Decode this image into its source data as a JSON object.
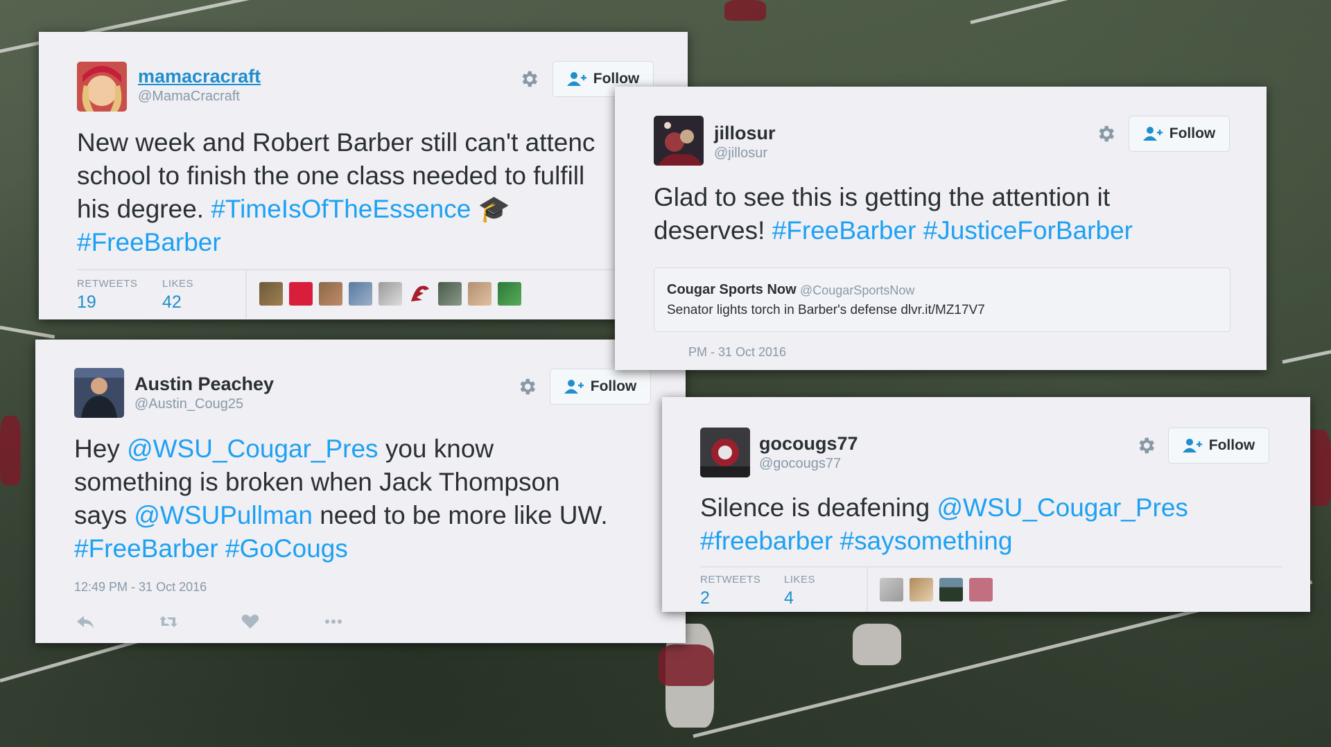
{
  "tweets": [
    {
      "display_name": "mamacracraft",
      "handle": "@MamaCracraft",
      "follow_label": "Follow",
      "text_lines": [
        [
          {
            "t": "New week and Robert Barber still can't attenc",
            "h": false
          }
        ],
        [
          {
            "t": "school to finish the one class needed to fulfill",
            "h": false
          }
        ],
        [
          {
            "t": "his degree. ",
            "h": false
          },
          {
            "t": "#TimeIsOfTheEssence",
            "h": true
          },
          {
            "t": " 🎓",
            "h": false
          }
        ],
        [
          {
            "t": "#FreeBarber",
            "h": true
          }
        ]
      ],
      "retweets_label": "RETWEETS",
      "retweets": "19",
      "likes_label": "LIKES",
      "likes": "42"
    },
    {
      "display_name": "jillosur",
      "handle": "@jillosur",
      "follow_label": "Follow",
      "text_lines": [
        [
          {
            "t": "Glad to see this is getting the attention it",
            "h": false
          }
        ],
        [
          {
            "t": "deserves! ",
            "h": false
          },
          {
            "t": "#FreeBarber #JusticeForBarber",
            "h": true
          }
        ]
      ],
      "quote": {
        "name": "Cougar Sports Now",
        "handle": "@CougarSportsNow",
        "text": "Senator lights torch in Barber's defense dlvr.it/MZ17V7"
      },
      "timestamp": "PM - 31 Oct 2016"
    },
    {
      "display_name": "Austin Peachey",
      "handle": "@Austin_Coug25",
      "follow_label": "Follow",
      "text_lines": [
        [
          {
            "t": "Hey ",
            "h": false
          },
          {
            "t": "@WSU_Cougar_Pres",
            "h": true
          },
          {
            "t": " you know",
            "h": false
          }
        ],
        [
          {
            "t": "something is broken when Jack Thompson",
            "h": false
          }
        ],
        [
          {
            "t": "says ",
            "h": false
          },
          {
            "t": "@WSUPullman",
            "h": true
          },
          {
            "t": " need to be more like UW.",
            "h": false
          }
        ],
        [
          {
            "t": "#FreeBarber #GoCougs",
            "h": true
          }
        ]
      ],
      "timestamp": "12:49 PM - 31 Oct 2016"
    },
    {
      "display_name": "gocougs77",
      "handle": "@gocougs77",
      "follow_label": "Follow",
      "text_lines": [
        [
          {
            "t": "Silence is deafening ",
            "h": false
          },
          {
            "t": "@WSU_Cougar_Pres",
            "h": true
          }
        ],
        [
          {
            "t": "#freebarber #saysomething",
            "h": true
          }
        ]
      ],
      "retweets_label": "RETWEETS",
      "retweets": "2",
      "likes_label": "LIKES",
      "likes": "4"
    }
  ],
  "icons": {
    "settings": "gear-icon",
    "follow": "add-user-icon",
    "reply": "reply-icon",
    "retweet": "retweet-icon",
    "like": "heart-icon",
    "more": "more-icon"
  },
  "colors": {
    "link": "#1da1f2",
    "card_bg": "#efeff4",
    "text": "#292f33",
    "muted": "#8899a6"
  }
}
